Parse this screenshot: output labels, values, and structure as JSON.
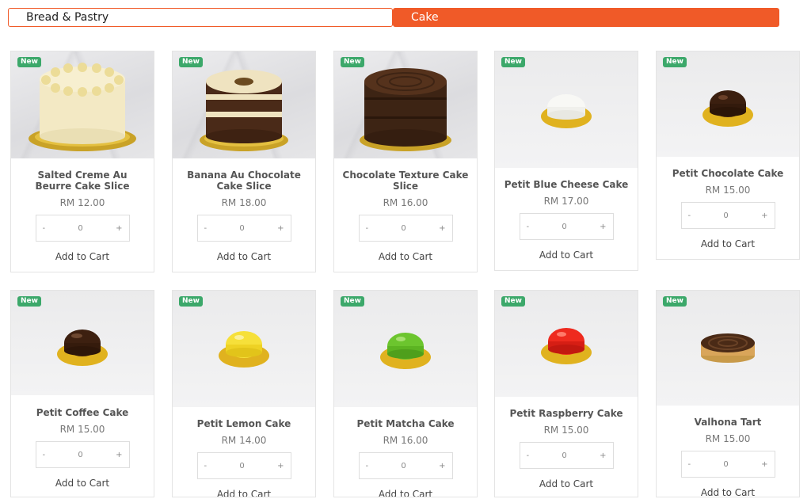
{
  "tabs": [
    {
      "label": "Bread & Pastry",
      "active": false
    },
    {
      "label": "Cake",
      "active": true
    }
  ],
  "colors": {
    "accent": "#f05a28",
    "badge": "#3ca86a"
  },
  "badge_label": "New",
  "add_to_cart_label": "Add to Cart",
  "products": [
    {
      "name": "Salted Creme Au Beurre Cake Slice",
      "price": "RM 12.00",
      "qty": "0",
      "minus": "-",
      "plus": "+"
    },
    {
      "name": "Banana Au Chocolate Cake Slice",
      "price": "RM 18.00",
      "qty": "0",
      "minus": "-",
      "plus": "+"
    },
    {
      "name": "Chocolate Texture Cake Slice",
      "price": "RM 16.00",
      "qty": "0",
      "minus": "-",
      "plus": "+"
    },
    {
      "name": "Petit Blue Cheese Cake",
      "price": "RM 17.00",
      "qty": "0",
      "minus": "-",
      "plus": "+"
    },
    {
      "name": "Petit Chocolate Cake",
      "price": "RM 15.00",
      "qty": "0",
      "minus": "-",
      "plus": "+"
    },
    {
      "name": "Petit Coffee Cake",
      "price": "RM 15.00",
      "qty": "0",
      "minus": "-",
      "plus": "+"
    },
    {
      "name": "Petit Lemon Cake",
      "price": "RM 14.00",
      "qty": "0",
      "minus": "-",
      "plus": "+"
    },
    {
      "name": "Petit Matcha Cake",
      "price": "RM 16.00",
      "qty": "0",
      "minus": "-",
      "plus": "+"
    },
    {
      "name": "Petit Raspberry Cake",
      "price": "RM 15.00",
      "qty": "0",
      "minus": "-",
      "plus": "+"
    },
    {
      "name": "Valhona Tart",
      "price": "RM 15.00",
      "qty": "0",
      "minus": "-",
      "plus": "+"
    }
  ]
}
